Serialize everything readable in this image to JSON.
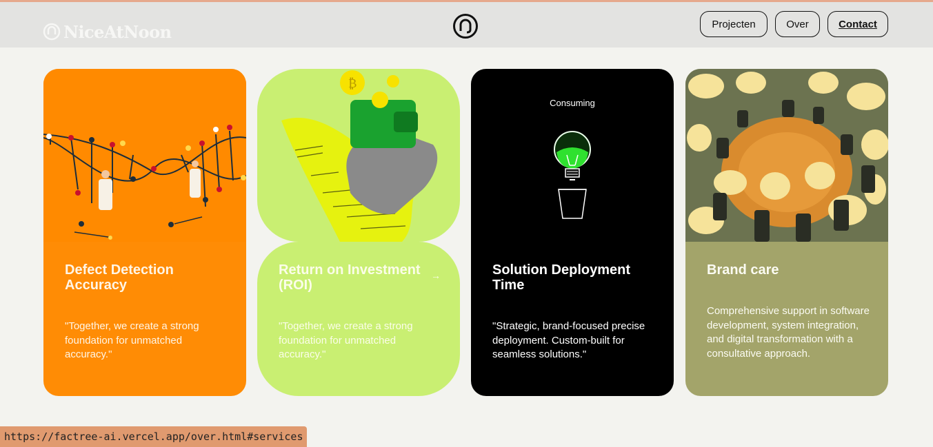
{
  "header": {
    "logo_text": "NiceAtNoon",
    "nav": [
      {
        "label": "Projecten"
      },
      {
        "label": "Over"
      },
      {
        "label": "Contact"
      }
    ]
  },
  "cards": [
    {
      "title": "Defect Detection Accuracy",
      "description": "\"Together, we create a strong foundation for unmatched accuracy.\""
    },
    {
      "title": "Return on Investment (ROI)",
      "description": "\"Together, we create a strong foundation for unmatched accuracy.\"",
      "arrow": "→"
    },
    {
      "title": "Solution Deployment Time",
      "description": "\"Strategic, brand-focused precise deployment. Custom-built for seamless solutions.\"",
      "image_caption": "Consuming"
    },
    {
      "title": "Brand care",
      "description": "Comprehensive support in software development, system integration, and digital transformation with a consultative approach."
    }
  ],
  "status_bar": {
    "url": "https://factree-ai.vercel.app/over.html#services"
  },
  "colors": {
    "orange": "#ff8c05",
    "lime": "#c9ef72",
    "black": "#000000",
    "olive": "#a3a46a"
  }
}
